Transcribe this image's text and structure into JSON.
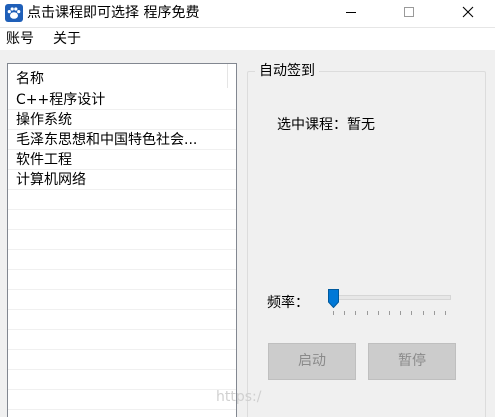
{
  "window": {
    "title": "点击课程即可选择 程序免费",
    "app_icon": "paw-icon",
    "controls": [
      "minimize-icon",
      "maximize-icon",
      "close-icon"
    ]
  },
  "menu": {
    "items": [
      {
        "label": "账号"
      },
      {
        "label": "关于"
      }
    ]
  },
  "course_list": {
    "column_header": "名称",
    "rows": [
      "C++程序设计",
      "操作系统",
      "毛泽东思想和中国特色社会...",
      "软件工程",
      "计算机网络"
    ]
  },
  "sign_in_panel": {
    "group_title": "自动签到",
    "selected_course_text": "选中课程：暂无",
    "frequency_label": "频率：",
    "frequency_slider": {
      "min": 0,
      "max": 10,
      "value": 0,
      "tick_count": 11
    },
    "start_button": "启动",
    "pause_button": "暂停"
  },
  "watermark_text": "https:/"
}
